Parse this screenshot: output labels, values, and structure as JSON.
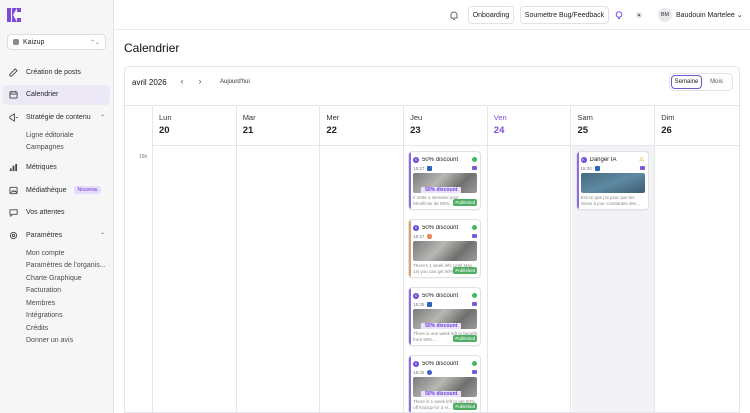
{
  "sidebar": {
    "workspace": "Kaizup",
    "items": [
      {
        "label": "Création de posts",
        "icon": "edit-icon",
        "name": "sidebar-item-creation-posts"
      },
      {
        "label": "Calendrier",
        "icon": "calendar-icon",
        "name": "sidebar-item-calendrier",
        "active": true
      },
      {
        "label": "Stratégie de contenu",
        "icon": "megaphone-icon",
        "name": "sidebar-item-strategie",
        "expanded": true,
        "children": [
          "Ligne éditoriale",
          "Campagnes"
        ]
      },
      {
        "label": "Métriques",
        "icon": "bar-chart-icon",
        "name": "sidebar-item-metriques"
      },
      {
        "label": "Médiathèque",
        "icon": "image-icon",
        "name": "sidebar-item-mediatheque",
        "badge": "Nouveau"
      },
      {
        "label": "Vos attentes",
        "icon": "chat-icon",
        "name": "sidebar-item-attentes"
      },
      {
        "label": "Paramètres",
        "icon": "gear-icon",
        "name": "sidebar-item-parametres",
        "expanded": true,
        "children": [
          "Mon compte",
          "Paramètres de l'organis...",
          "Charte Graphique",
          "Facturation",
          "Membres",
          "Intégrations",
          "Crédits",
          "Donner un avis"
        ]
      }
    ]
  },
  "topbar": {
    "onboarding": "Onboarding",
    "bug": "Soumettre Bug/Feedback",
    "initials": "BM",
    "user": "Baudouin Martelee"
  },
  "page": {
    "title": "Calendrier"
  },
  "calendar": {
    "month": "avril 2026",
    "today_label": "Aujourd'hui",
    "views": [
      "Semaine",
      "Mois"
    ],
    "active_view": "Semaine",
    "hour_label": "15h",
    "days": [
      {
        "name": "Lun",
        "num": "20"
      },
      {
        "name": "Mar",
        "num": "21"
      },
      {
        "name": "Mer",
        "num": "22"
      },
      {
        "name": "Jeu",
        "num": "23"
      },
      {
        "name": "Ven",
        "num": "24",
        "today": true
      },
      {
        "name": "Sam",
        "num": "25"
      },
      {
        "name": "Dim",
        "num": "26"
      }
    ],
    "events": [
      {
        "day": 3,
        "title": "50% discount",
        "time": "15:27",
        "network": "linkedin",
        "promo": "50% discount",
        "text": "Il reste 1 semaine pour bénéficier de 50%...",
        "status": "Published"
      },
      {
        "day": 3,
        "title": "50% discount",
        "time": "15:27",
        "network": "instagram",
        "promo": "",
        "text": "There's 1 week left. Until May 1st you can get 50%...",
        "status": "Published",
        "alt": true
      },
      {
        "day": 3,
        "title": "50% discount",
        "time": "15:35",
        "network": "linkedin",
        "promo": "50% discount",
        "text": "There is one week left to benefit from 50%...",
        "status": "Published"
      },
      {
        "day": 3,
        "title": "50% discount",
        "time": "15:32",
        "network": "facebook",
        "promo": "50% discount",
        "text": "There is 1 week left to get 50% off Kaizup for 3 m...",
        "status": "Published"
      },
      {
        "day": 5,
        "title": "Danger IA",
        "time": "15:30",
        "network": "linkedin",
        "promo": "",
        "text": "Est-ce que j'ai peur que les mises à jour constantes des...",
        "warning": true
      }
    ]
  }
}
